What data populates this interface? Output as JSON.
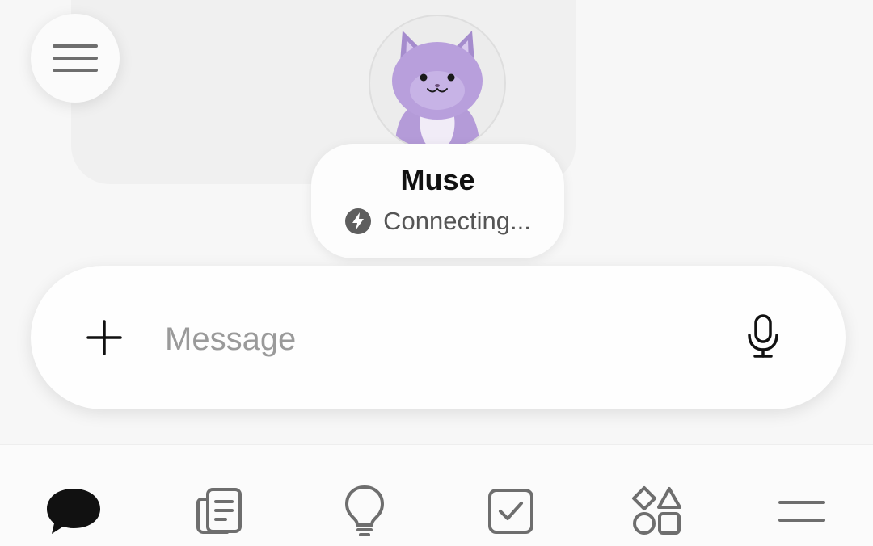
{
  "agent": {
    "name": "Muse",
    "status": "Connecting...",
    "status_icon": "lightning-bolt-icon",
    "avatar_icon": "purple-cat-avatar"
  },
  "composer": {
    "placeholder": "Message",
    "value": "",
    "attach_icon": "plus-icon",
    "voice_icon": "microphone-icon"
  },
  "header": {
    "menu_icon": "hamburger-menu-icon"
  },
  "tabs": [
    {
      "icon": "chat-bubble-icon",
      "active": true
    },
    {
      "icon": "notes-icon",
      "active": false
    },
    {
      "icon": "lightbulb-icon",
      "active": false
    },
    {
      "icon": "checkbox-icon",
      "active": false
    },
    {
      "icon": "shapes-icon",
      "active": false
    },
    {
      "icon": "more-menu-icon",
      "active": false
    }
  ],
  "colors": {
    "avatar_purple": "#b39ddb",
    "active_tab": "#111111",
    "inactive_tab": "#6e6e6e"
  }
}
